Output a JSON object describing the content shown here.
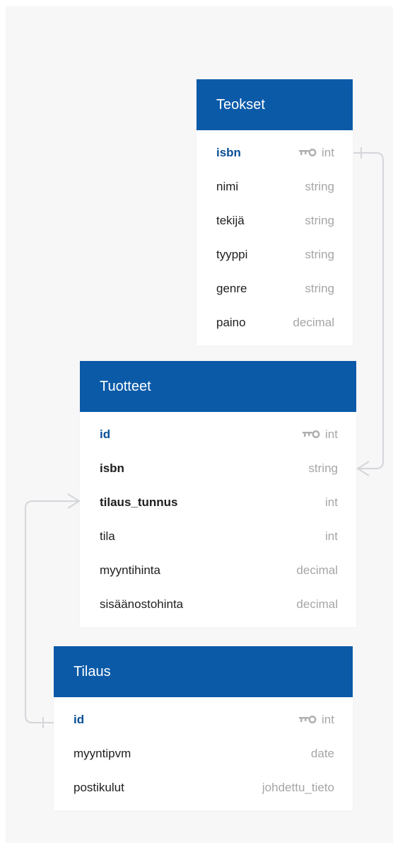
{
  "tables": {
    "teokset": {
      "name": "Teokset",
      "fields": [
        {
          "name": "isbn",
          "type": "int",
          "pk": true
        },
        {
          "name": "nimi",
          "type": "string"
        },
        {
          "name": "tekijä",
          "type": "string"
        },
        {
          "name": "tyyppi",
          "type": "string"
        },
        {
          "name": "genre",
          "type": "string"
        },
        {
          "name": "paino",
          "type": "decimal"
        }
      ]
    },
    "tuotteet": {
      "name": "Tuotteet",
      "fields": [
        {
          "name": "id",
          "type": "int",
          "pk": true
        },
        {
          "name": "isbn",
          "type": "string",
          "bold": true
        },
        {
          "name": "tilaus_tunnus",
          "type": "int",
          "bold": true
        },
        {
          "name": "tila",
          "type": "int"
        },
        {
          "name": "myyntihinta",
          "type": "decimal"
        },
        {
          "name": "sisäänostohinta",
          "type": "decimal"
        }
      ]
    },
    "tilaus": {
      "name": "Tilaus",
      "fields": [
        {
          "name": "id",
          "type": "int",
          "pk": true
        },
        {
          "name": "myyntipvm",
          "type": "date"
        },
        {
          "name": "postikulut",
          "type": "johdettu_tieto"
        }
      ]
    }
  },
  "relations": [
    {
      "from": "teokset.isbn",
      "to": "tuotteet.isbn",
      "from_end": "one",
      "to_end": "many"
    },
    {
      "from": "tilaus.id",
      "to": "tuotteet.tilaus_tunnus",
      "from_end": "one",
      "to_end": "many"
    }
  ],
  "colors": {
    "header": "#0a5aa8",
    "primary_key": "#0a4f96",
    "type_text": "#a6a6a6",
    "connector": "#d4d6da",
    "canvas": "#f7f7f8"
  },
  "icons": {
    "primary_key": "key-icon"
  }
}
